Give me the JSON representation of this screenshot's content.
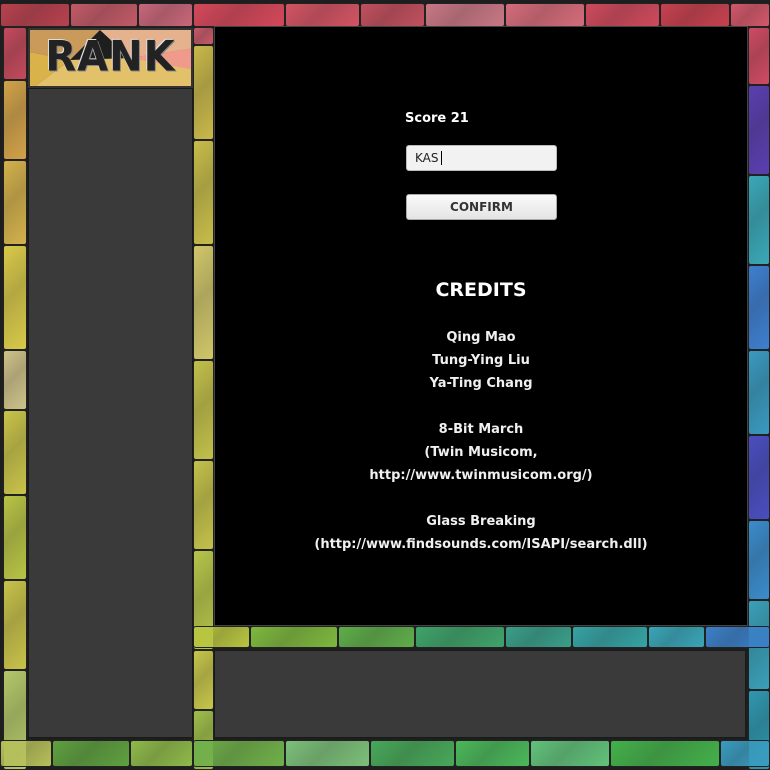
{
  "rank": {
    "title": "RANK"
  },
  "score": {
    "label": "Score",
    "value": "21",
    "text": "Score  21"
  },
  "name_input": {
    "value": "KAS"
  },
  "confirm_button": {
    "label": "CONFIRM"
  },
  "credits": {
    "title": "CREDITS",
    "lines": [
      "Qing Mao",
      "Tung-Ying Liu",
      "Ya-Ting Chang",
      "",
      "8-Bit March",
      "(Twin Musicom,",
      "http://www.twinmusicom.org/)",
      "",
      "Glass Breaking",
      "(http://www.findsounds.com/ISAPI/search.dll)"
    ]
  },
  "colors": {
    "background": "#000000",
    "panel": "#3a3a3a",
    "text": "#ffffff",
    "glass_palette": [
      "#c0384a",
      "#cf6f7a",
      "#d9a84a",
      "#d8c84a",
      "#b9c540",
      "#89b83e",
      "#5bb24a",
      "#3fa38a",
      "#36a9b4",
      "#3b7ec9",
      "#4a4fb8",
      "#6a3fa3"
    ]
  }
}
